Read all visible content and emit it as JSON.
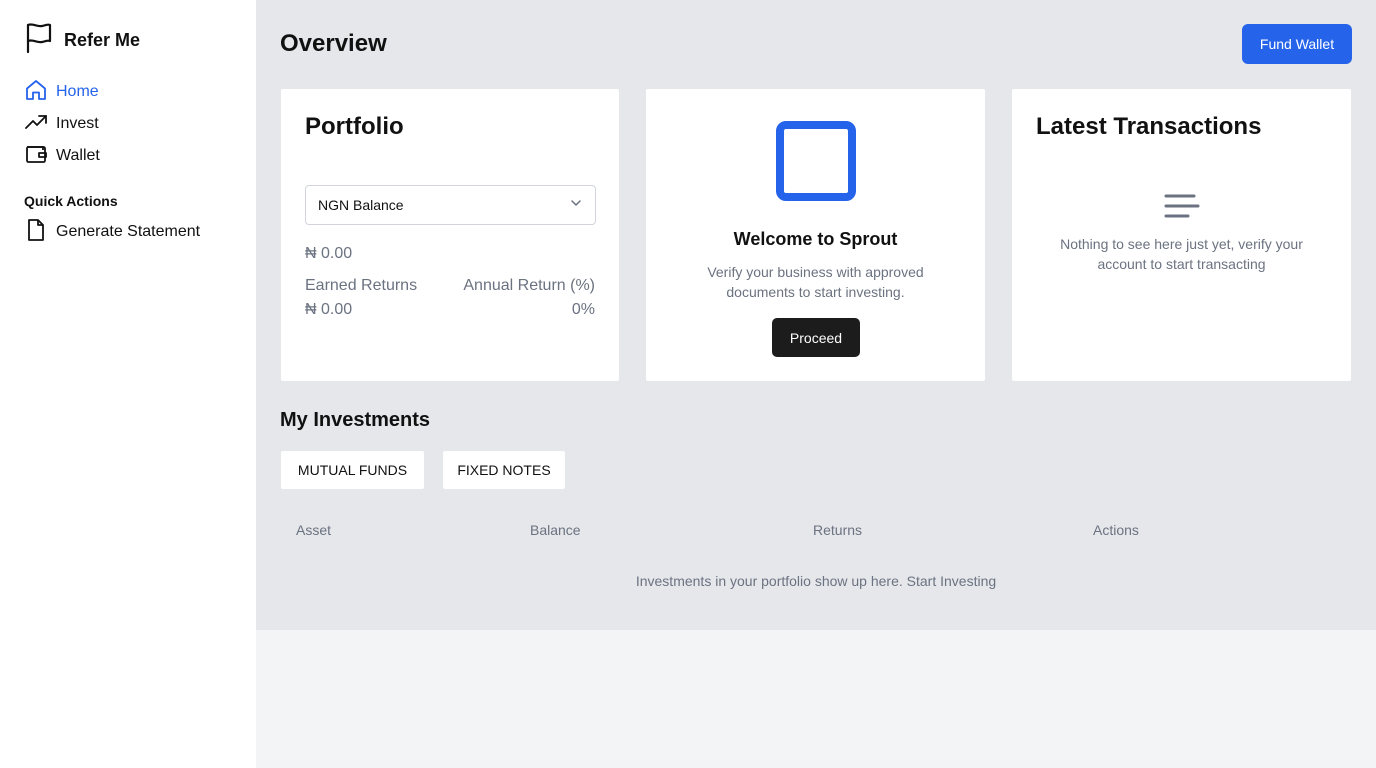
{
  "sidebar": {
    "brand": "Refer Me",
    "nav": [
      {
        "label": "Home",
        "icon": "home-icon",
        "active": true
      },
      {
        "label": "Invest",
        "icon": "trending-up-icon",
        "active": false
      },
      {
        "label": "Wallet",
        "icon": "wallet-icon",
        "active": false
      }
    ],
    "quick_actions": {
      "heading": "Quick Actions",
      "items": [
        {
          "label": "Generate Statement",
          "icon": "document-icon"
        }
      ]
    }
  },
  "header": {
    "title": "Overview",
    "fund_wallet_label": "Fund Wallet"
  },
  "portfolio": {
    "title": "Portfolio",
    "select_value": "NGN Balance",
    "balance": "₦ 0.00",
    "earned_returns_label": "Earned Returns",
    "earned_returns_value": "₦ 0.00",
    "annual_return_label": "Annual Return (%)",
    "annual_return_value": "0%"
  },
  "welcome": {
    "title": "Welcome to Sprout",
    "text": "Verify your business with approved documents to start investing.",
    "button_label": "Proceed"
  },
  "transactions": {
    "title": "Latest Transactions",
    "empty_text": "Nothing to see here just yet, verify your account to start transacting"
  },
  "investments": {
    "title": "My Investments",
    "tabs": [
      "MUTUAL FUNDS",
      "FIXED NOTES"
    ],
    "columns": [
      "Asset",
      "Balance",
      "Returns",
      "Actions"
    ],
    "empty_text": "Investments in your portfolio show up here. Start Investing"
  },
  "colors": {
    "accent": "#2563eb",
    "dark_button": "#1c1c1c",
    "main_bg": "#e5e7eb",
    "muted_text": "#6b7280"
  }
}
